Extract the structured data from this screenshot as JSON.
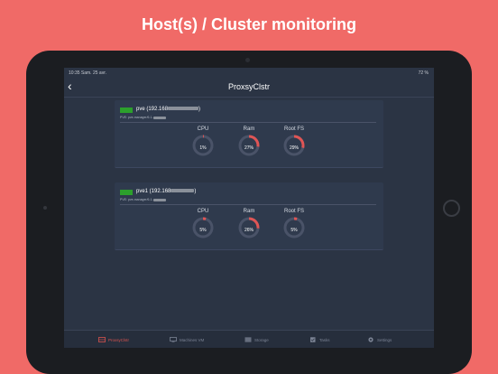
{
  "headline": "Host(s) / Cluster monitoring",
  "status_bar": {
    "time": "10:35  Sam. 25 avr.",
    "battery": "72 %"
  },
  "nav": {
    "title": "ProxsyClstr",
    "back_icon": "chevron-left-icon"
  },
  "hosts": [
    {
      "name": "pve (192.168",
      "subtitle": "PVE: pve-manager/6.1-",
      "status_color": "#2ca02c",
      "metrics": [
        {
          "label": "CPU",
          "value_text": "1%",
          "percent": 1
        },
        {
          "label": "Ram",
          "value_text": "27%",
          "percent": 27
        },
        {
          "label": "Root FS",
          "value_text": "29%",
          "percent": 29
        }
      ]
    },
    {
      "name": "pve1 (192.168",
      "subtitle": "PVE: pve-manager/6.1-",
      "status_color": "#2ca02c",
      "metrics": [
        {
          "label": "CPU",
          "value_text": "5%",
          "percent": 5
        },
        {
          "label": "Ram",
          "value_text": "26%",
          "percent": 26
        },
        {
          "label": "Root FS",
          "value_text": "5%",
          "percent": 5
        }
      ]
    }
  ],
  "tabs": [
    {
      "label": "ProxsyClstr",
      "icon": "cluster-icon",
      "active": true
    },
    {
      "label": "Machines VM",
      "icon": "monitor-icon",
      "active": false
    },
    {
      "label": "Storage",
      "icon": "storage-icon",
      "active": false
    },
    {
      "label": "Tasks",
      "icon": "tasks-icon",
      "active": false
    },
    {
      "label": "Settings",
      "icon": "gear-icon",
      "active": false
    }
  ],
  "colors": {
    "gauge_accent": "#e05555",
    "gauge_track": "#4a5368",
    "background": "#f06a67"
  }
}
